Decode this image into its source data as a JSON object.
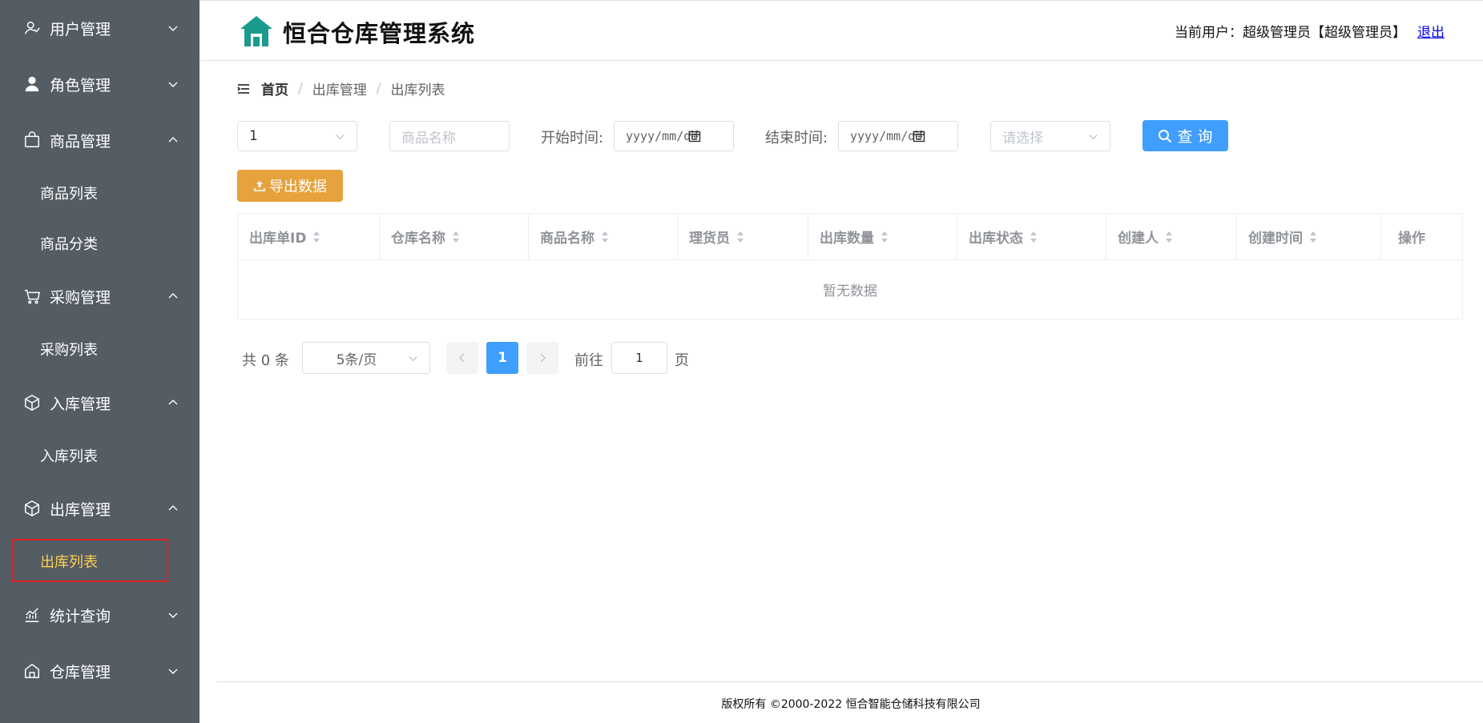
{
  "sidebar": {
    "menus": [
      {
        "label": "用户管理",
        "icon": "user-icon",
        "expanded": false
      },
      {
        "label": "角色管理",
        "icon": "person-filled-icon",
        "expanded": false
      },
      {
        "label": "商品管理",
        "icon": "shopping-bag-icon",
        "expanded": true
      },
      {
        "label": "采购管理",
        "icon": "shopping-cart-icon",
        "expanded": true
      },
      {
        "label": "入库管理",
        "icon": "box-icon",
        "expanded": true
      },
      {
        "label": "出库管理",
        "icon": "box-out-icon",
        "expanded": true
      },
      {
        "label": "统计查询",
        "icon": "chart-icon",
        "expanded": false
      },
      {
        "label": "仓库管理",
        "icon": "warehouse-icon",
        "expanded": false
      }
    ],
    "subitems": {
      "goods_list": "商品列表",
      "goods_category": "商品分类",
      "purchase_list": "采购列表",
      "inbound_list": "入库列表",
      "outbound_list": "出库列表"
    },
    "active": "出库列表"
  },
  "header": {
    "app_title": "恒合仓库管理系统",
    "current_user_label": "当前用户：超级管理员【超级管理员】",
    "logout_label": "退出"
  },
  "breadcrumb": {
    "home": "首页",
    "level1": "出库管理",
    "level2": "出库列表",
    "separator": "/"
  },
  "filters": {
    "warehouse_value": "1",
    "goods_placeholder": "商品名称",
    "start_label": "开始时间:",
    "start_placeholder": "yyyy/mm/dd",
    "end_label": "结束时间:",
    "end_placeholder": "yyyy/mm/dd",
    "status_placeholder": "请选择",
    "query_label": "查 询",
    "export_label": "导出数据"
  },
  "table": {
    "columns": [
      "出库单ID",
      "仓库名称",
      "商品名称",
      "理货员",
      "出库数量",
      "出库状态",
      "创建人",
      "创建时间",
      "操作"
    ],
    "empty_text": "暂无数据"
  },
  "pagination": {
    "total_label": "共 0 条",
    "page_size_label": "5条/页",
    "current_page": "1",
    "goto_label": "前往",
    "goto_value": "1",
    "page_suffix": "页"
  },
  "footer": {
    "copyright": "版权所有 ©2000-2022  恒合智能仓储科技有限公司"
  },
  "colors": {
    "sidebar_bg": "#545c64",
    "active_text": "#ffd04b",
    "primary": "#409eff",
    "warning": "#e6a23c",
    "logo": "#1a9b8e"
  }
}
